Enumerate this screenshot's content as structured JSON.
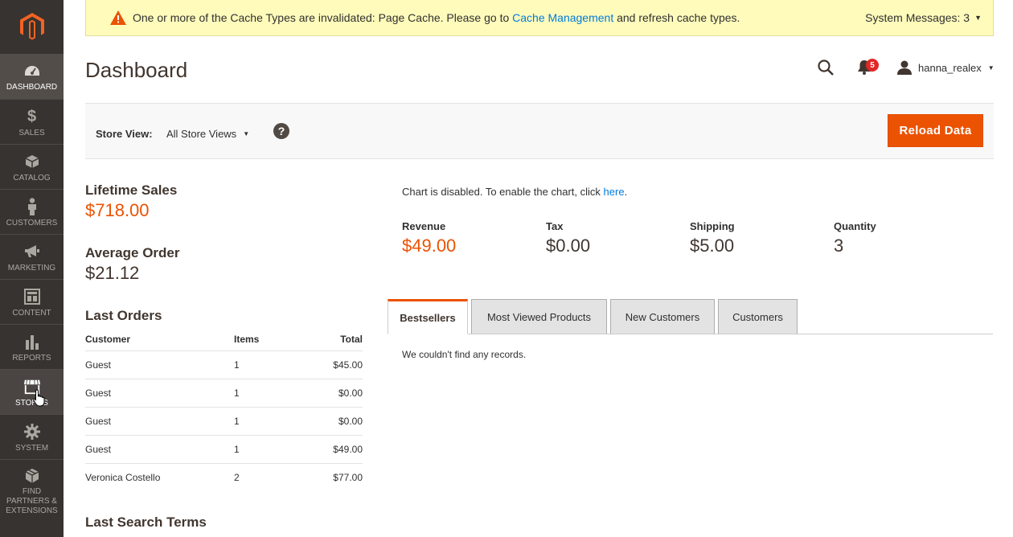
{
  "sidebar": {
    "items": [
      {
        "label": "DASHBOARD",
        "icon": "dashboard-icon"
      },
      {
        "label": "SALES",
        "icon": "dollar-icon"
      },
      {
        "label": "CATALOG",
        "icon": "box-icon"
      },
      {
        "label": "CUSTOMERS",
        "icon": "person-icon"
      },
      {
        "label": "MARKETING",
        "icon": "megaphone-icon"
      },
      {
        "label": "CONTENT",
        "icon": "layout-icon"
      },
      {
        "label": "REPORTS",
        "icon": "bar-chart-icon"
      },
      {
        "label": "STORES",
        "icon": "storefront-icon"
      },
      {
        "label": "SYSTEM",
        "icon": "gear-icon"
      },
      {
        "label": "FIND PARTNERS & EXTENSIONS",
        "icon": "boxes-icon"
      }
    ]
  },
  "system_message": {
    "text_before": "One or more of the Cache Types are invalidated: Page Cache. Please go to",
    "link": "Cache Management",
    "text_after": "and refresh cache types.",
    "count_label": "System Messages: 3"
  },
  "header": {
    "title": "Dashboard",
    "notification_count": "5",
    "username": "hanna_realex"
  },
  "store_view": {
    "label": "Store View:",
    "selected": "All Store Views",
    "help": "?",
    "reload_button": "Reload Data"
  },
  "stats": {
    "lifetime_sales_label": "Lifetime Sales",
    "lifetime_sales_value": "$718.00",
    "average_order_label": "Average Order",
    "average_order_value": "$21.12"
  },
  "last_orders": {
    "title": "Last Orders",
    "columns": [
      "Customer",
      "Items",
      "Total"
    ],
    "rows": [
      [
        "Guest",
        "1",
        "$45.00"
      ],
      [
        "Guest",
        "1",
        "$0.00"
      ],
      [
        "Guest",
        "1",
        "$0.00"
      ],
      [
        "Guest",
        "1",
        "$49.00"
      ],
      [
        "Veronica Costello",
        "2",
        "$77.00"
      ]
    ]
  },
  "last_search_terms": {
    "title": "Last Search Terms"
  },
  "chart": {
    "message": "Chart is disabled. To enable the chart, click",
    "link": "here",
    "period": "."
  },
  "totals": {
    "revenue_label": "Revenue",
    "revenue_value": "$49.00",
    "tax_label": "Tax",
    "tax_value": "$0.00",
    "shipping_label": "Shipping",
    "shipping_value": "$5.00",
    "quantity_label": "Quantity",
    "quantity_value": "3"
  },
  "tabs": {
    "items": [
      "Bestsellers",
      "Most Viewed Products",
      "New Customers",
      "Customers"
    ],
    "content": "We couldn't find any records."
  },
  "colors": {
    "accent": "#eb5202",
    "sidebar": "#373330",
    "link": "#007bdb",
    "warning_bg": "#fffbbb"
  }
}
